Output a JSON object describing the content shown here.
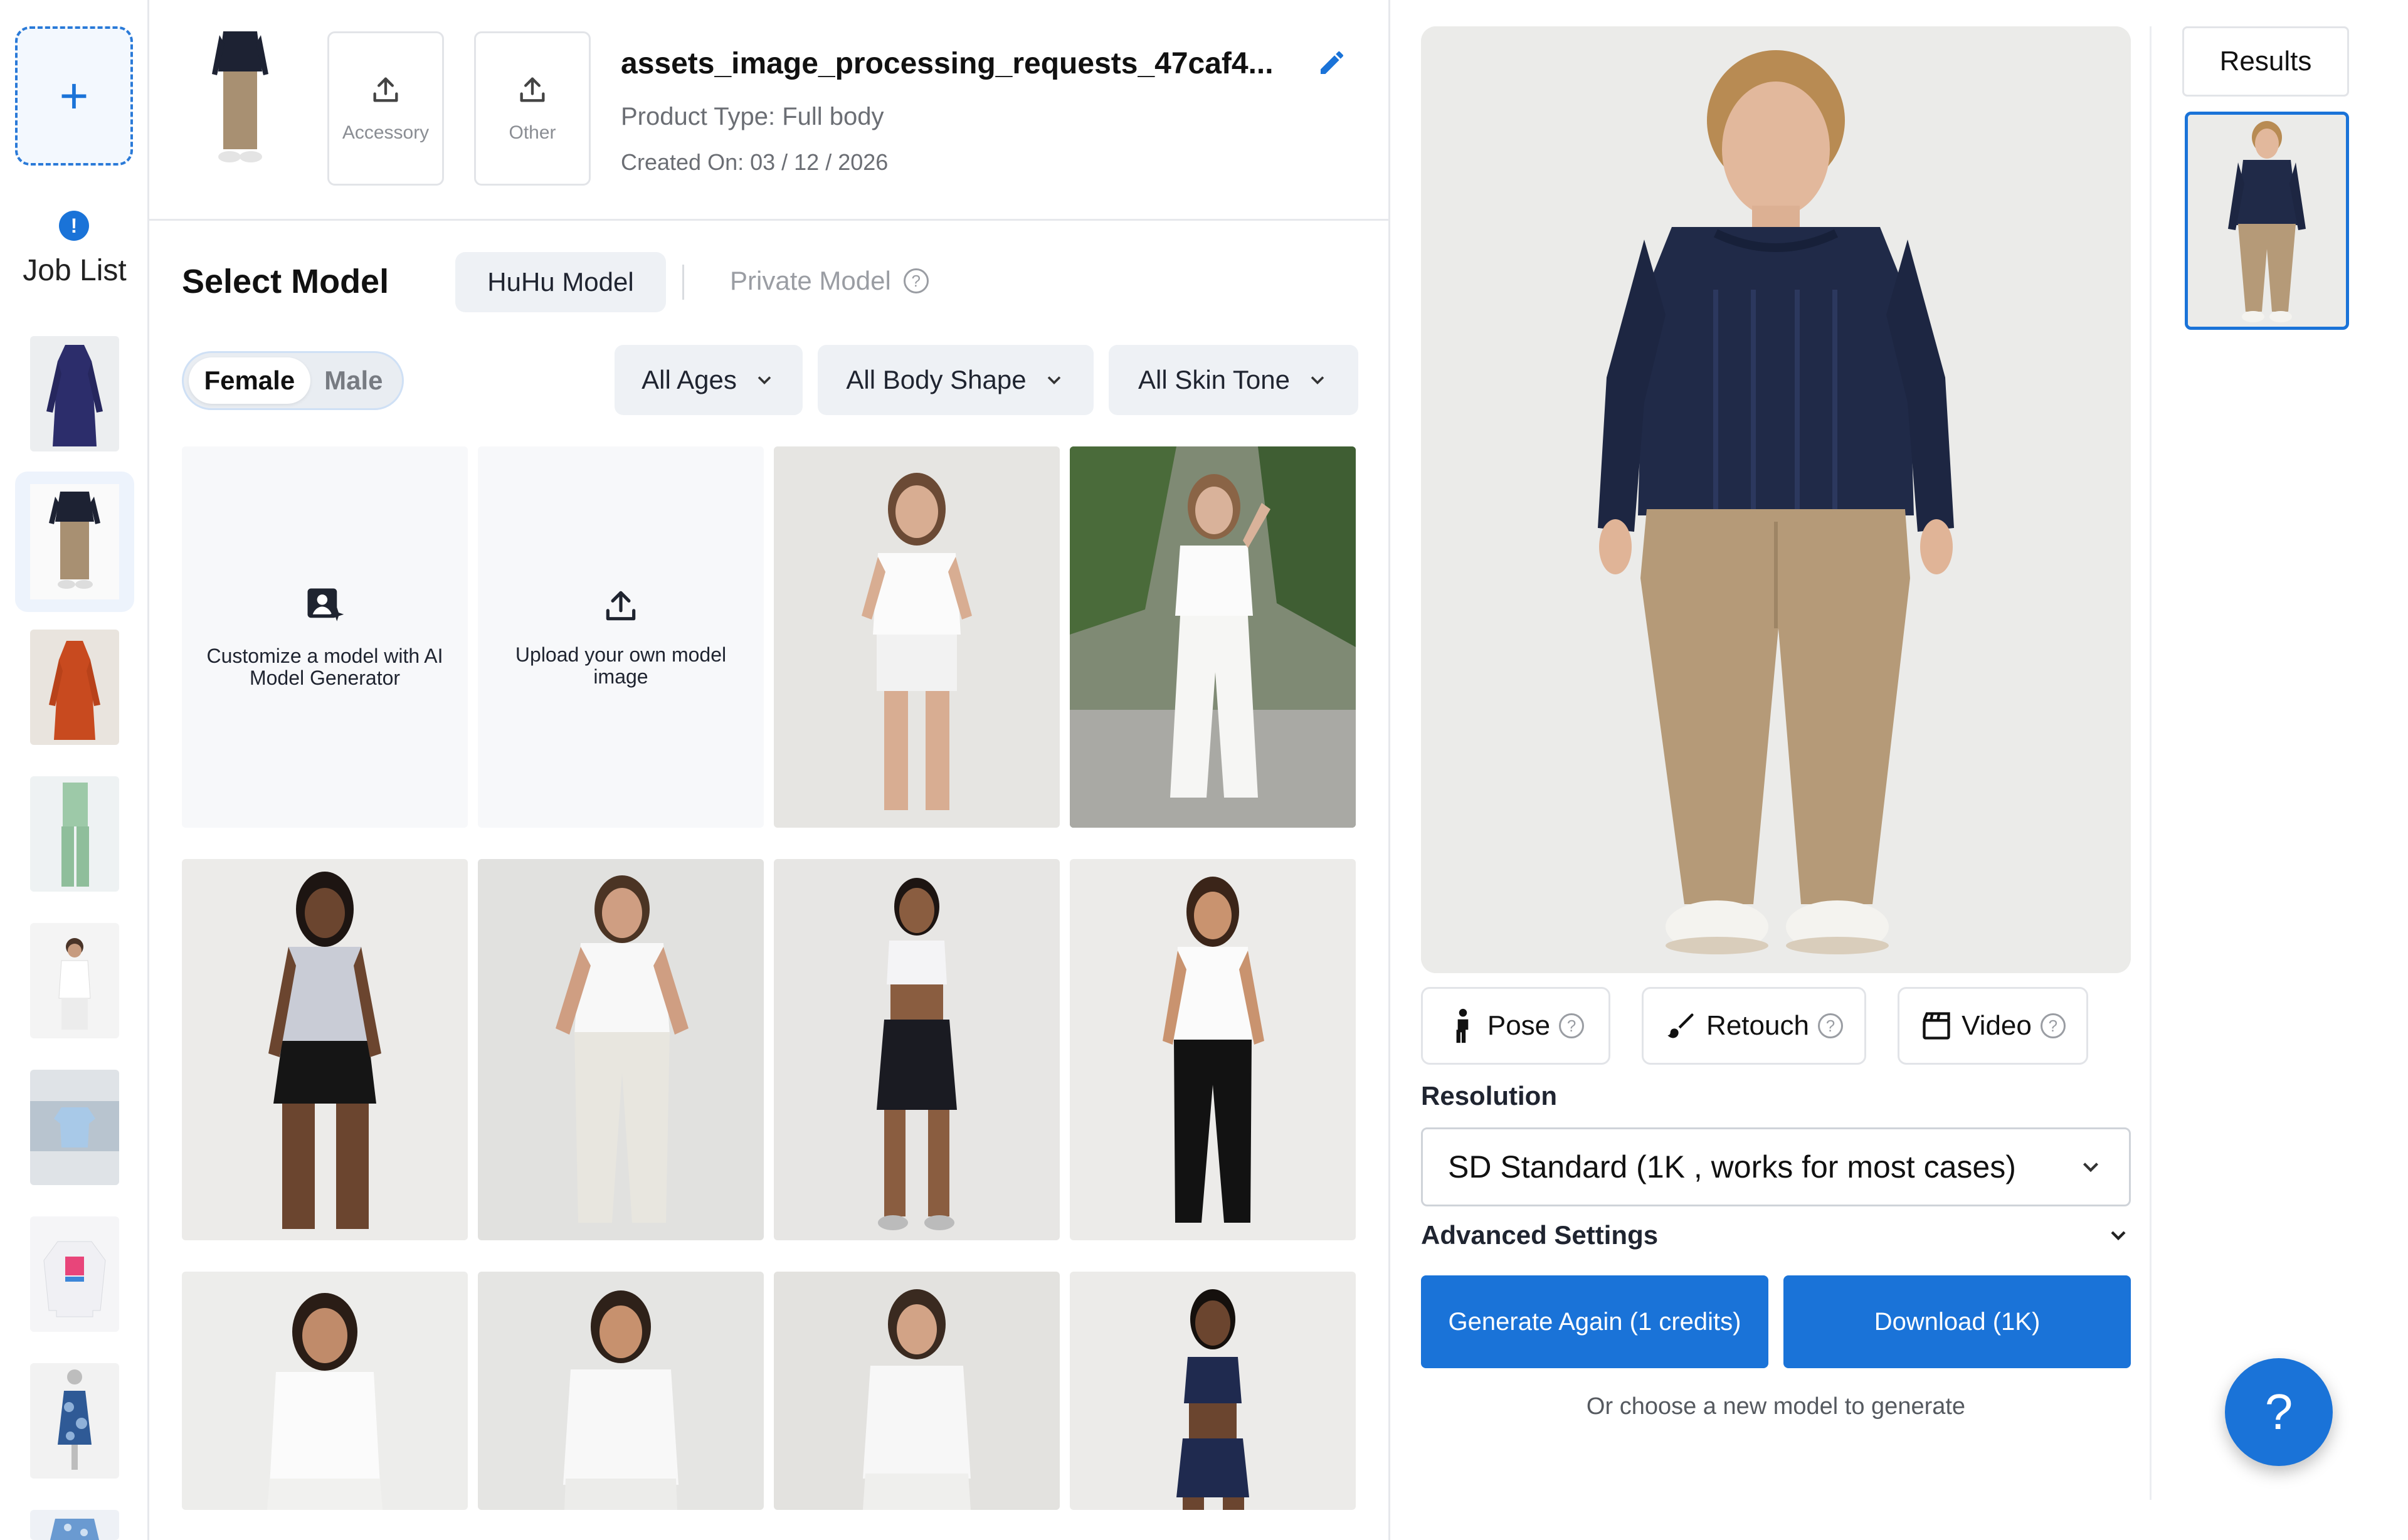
{
  "job_rail": {
    "new_job_symbol": "+",
    "alert_symbol": "!",
    "label": "Job List"
  },
  "product": {
    "upload_accessory_label": "Accessory",
    "upload_other_label": "Other",
    "title": "assets_image_processing_requests_47caf4...",
    "type_text": "Product Type: Full body",
    "created_text": "Created On: 03 / 12 / 2026"
  },
  "select_model": {
    "title": "Select Model",
    "tab_huhu": "HuHu Model",
    "tab_private": "Private Model",
    "gender_female": "Female",
    "gender_male": "Male",
    "filter_ages": "All Ages",
    "filter_body": "All Body Shape",
    "filter_skin": "All Skin Tone",
    "customize_text": "Customize a model with AI Model Generator",
    "upload_own_text": "Upload your own model image"
  },
  "tools": {
    "pose": "Pose",
    "retouch": "Retouch",
    "video": "Video",
    "help_symbol": "?"
  },
  "resolution": {
    "label": "Resolution",
    "selected": "SD Standard (1K , works for most cases)"
  },
  "advanced_settings": "Advanced Settings",
  "actions": {
    "generate": "Generate Again (1 credits)",
    "download": "Download (1K)",
    "hint": "Or choose a new model to generate"
  },
  "results": {
    "button": "Results"
  },
  "help_fab": "?",
  "colors": {
    "accent": "#1a73d8",
    "border": "#e2e4e8",
    "chip_bg": "#eef1f5"
  }
}
